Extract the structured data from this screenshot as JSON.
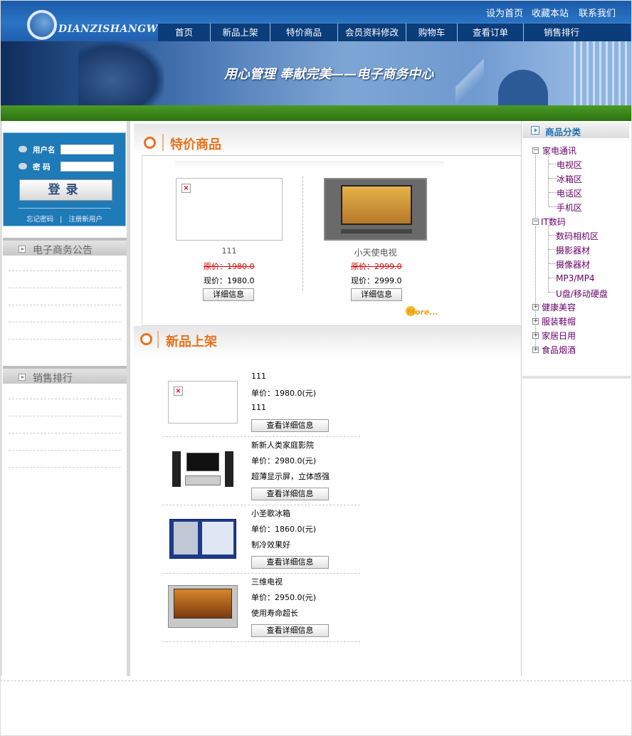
{
  "header": {
    "logo_text": "DIANZISHANGWU",
    "top_links": [
      "设为首页",
      "收藏本站",
      "联系我们"
    ],
    "nav": [
      "首页",
      "新品上架",
      "特价商品",
      "会员资料修改",
      "购物车",
      "查看订单",
      "销售排行"
    ],
    "slogan": "用心管理 奉献完美——电子商务中心"
  },
  "login": {
    "username_label": "用户名",
    "password_label": "密 码",
    "login_button": "登录",
    "forgot": "忘记密码",
    "separator": "|",
    "register": "注册新用户"
  },
  "sidebar": {
    "announcement_title": "电子商务公告",
    "ranking_title": "销售排行"
  },
  "specials": {
    "title": "特价商品",
    "original_price_label": "原价：",
    "current_price_label": "现价：",
    "items": [
      {
        "name": "111",
        "original_price": "1980.0",
        "current_price": "1980.0",
        "button": "详细信息"
      },
      {
        "name": "小天使电视",
        "original_price": "2999.0",
        "current_price": "2999.0",
        "button": "详细信息"
      }
    ],
    "more": "More..."
  },
  "new_products": {
    "title": "新品上架",
    "price_label": "单价：",
    "items": [
      {
        "name": "111",
        "price": "1980.0(元)",
        "desc": "111",
        "button": "查看详细信息"
      },
      {
        "name": "新新人类家庭影院",
        "price": "2980.0(元)",
        "desc": "超薄显示屏，立体感强",
        "button": "查看详细信息"
      },
      {
        "name": "小圣歌冰箱",
        "price": "1860.0(元)",
        "desc": "制冷效果好",
        "button": "查看详细信息"
      },
      {
        "name": "三维电视",
        "price": "2950.0(元)",
        "desc": "使用寿命超长",
        "button": "查看详细信息"
      }
    ]
  },
  "categories": {
    "title": "商品分类",
    "groups": [
      {
        "label": "家电通讯",
        "expanded": true,
        "children": [
          "电视区",
          "冰箱区",
          "电话区",
          "手机区"
        ]
      },
      {
        "label": "IT数码",
        "expanded": true,
        "children": [
          "数码相机区",
          "摄影器材",
          "摄像器材",
          "MP3/MP4",
          "U盘/移动硬盘"
        ]
      },
      {
        "label": "健康美容",
        "expanded": false,
        "children": []
      },
      {
        "label": "服装鞋帽",
        "expanded": false,
        "children": []
      },
      {
        "label": "家居日用",
        "expanded": false,
        "children": []
      },
      {
        "label": "食品烟酒",
        "expanded": false,
        "children": []
      }
    ]
  },
  "colors": {
    "accent": "#e8731a",
    "header_blue": "#1a5aa8",
    "nav_blue": "#0b3d7a",
    "green_bar": "#3a8a1a",
    "tree_text": "#660066",
    "old_price": "#dd0000"
  }
}
